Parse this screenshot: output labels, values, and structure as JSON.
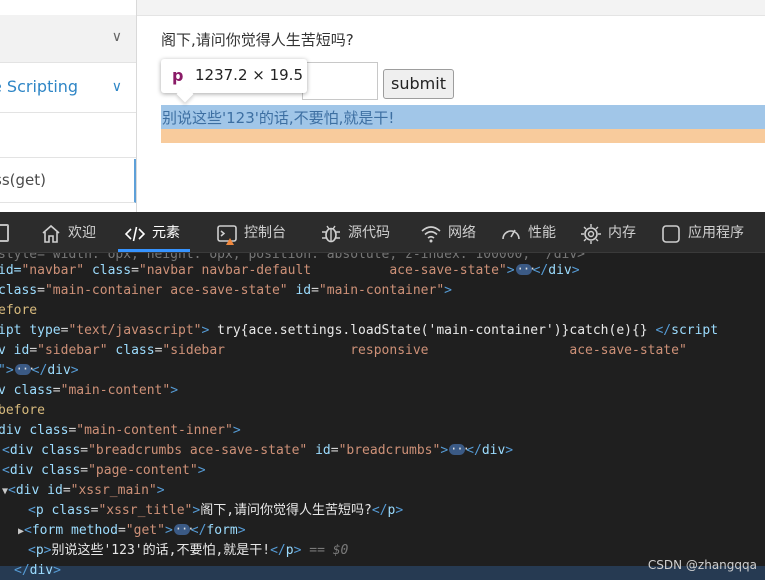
{
  "page": {
    "sidebar": {
      "item_scripting": "e Scripting",
      "item_get": "ss(get)"
    },
    "question": "阁下,请问你觉得人生苦短吗?",
    "submit_label": "submit",
    "result_text": "别说这些'123'的话,不要怕,就是干!",
    "tooltip": {
      "tag": "p",
      "dims": "1237.2 × 19.5"
    }
  },
  "devtools": {
    "tabs": [
      {
        "label": "欢迎",
        "icon": "home-icon"
      },
      {
        "label": "元素",
        "icon": "code-icon"
      },
      {
        "label": "控制台",
        "icon": "console-icon"
      },
      {
        "label": "源代码",
        "icon": "bug-icon"
      },
      {
        "label": "网络",
        "icon": "wifi-icon"
      },
      {
        "label": "性能",
        "icon": "gauge-icon"
      },
      {
        "label": "内存",
        "icon": "chip-icon"
      },
      {
        "label": "应用程序",
        "icon": "app-icon"
      }
    ],
    "active_tab": "元素",
    "code_lines": {
      "l0": "style= width: opx; height: opx; position: absolute; z-index: 100000; \"/div>",
      "l1_pre": "id=",
      "l1_id": "\"navbar\"",
      "l1_cls": "\"navbar navbar-default          ace-save-state\"",
      "l2_cls": "\"main-container ace-save-state\"",
      "l2_id": "\"main-container\"",
      "l3": "efore",
      "l4_type": "\"text/javascript\"",
      "l4_body": "try{ace.settings.loadState('main-container')}catch(e){}",
      "l5_id": "\"sidebar\"",
      "l5_cls": "\"sidebar                responsive                  ace-save-state\"",
      "l7_cls": "\"main-content\"",
      "l8": "before",
      "l9_cls": "\"main-content-inner\"",
      "l10_cls": "\"breadcrumbs ace-save-state\"",
      "l10_id": "\"breadcrumbs\"",
      "l11_cls": "\"page-content\"",
      "l12_id": "\"xssr_main\"",
      "l13_cls": "\"xssr_title\"",
      "l13_text": "阁下,请问你觉得人生苦短吗?",
      "l14_method": "\"get\"",
      "l15_text": "别说这些'123'的话,不要怕,就是干!",
      "l15_marker": "== $0"
    }
  },
  "watermark": "CSDN @zhangqqa"
}
